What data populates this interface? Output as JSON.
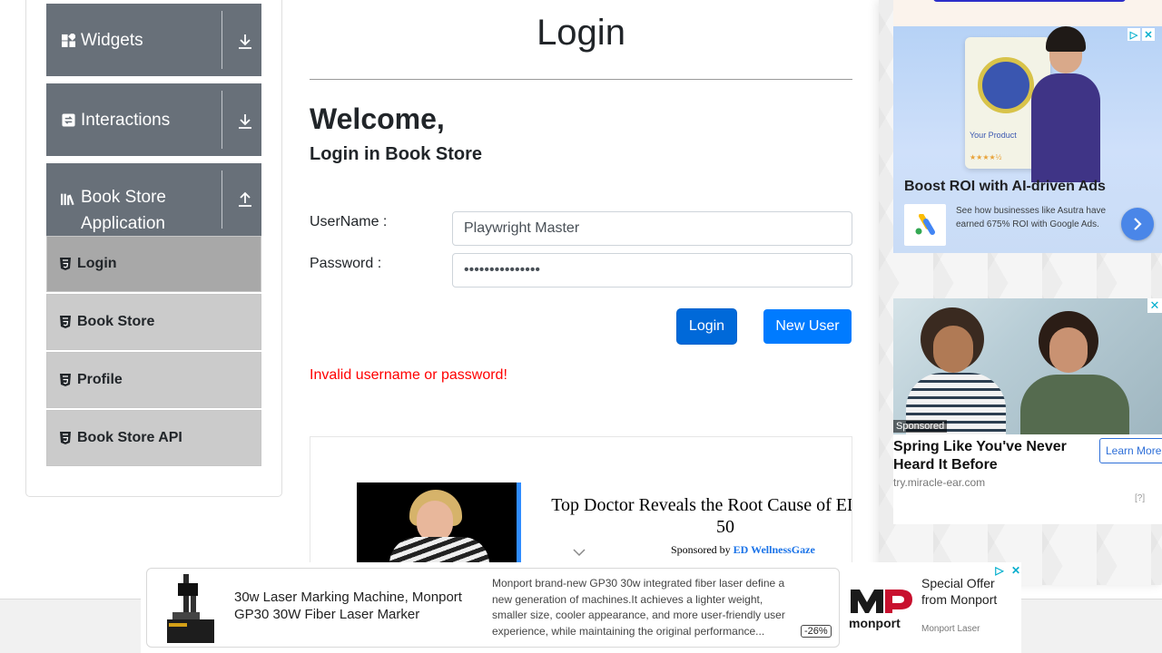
{
  "sidebar": {
    "groups": [
      {
        "title": "Widgets",
        "icon": "widgets-icon",
        "arrow": "download-arrow-icon"
      },
      {
        "title": "Interactions",
        "icon": "interactions-icon",
        "arrow": "download-arrow-icon"
      },
      {
        "title": "Book Store Application",
        "icon": "book-store-icon",
        "arrow": "upload-arrow-icon"
      }
    ],
    "menu_items": [
      {
        "label": "Login",
        "active": true
      },
      {
        "label": "Book Store",
        "active": false
      },
      {
        "label": "Profile",
        "active": false
      },
      {
        "label": "Book Store API",
        "active": false
      }
    ]
  },
  "main": {
    "title": "Login",
    "welcome": "Welcome,",
    "subtitle": "Login in Book Store",
    "username_label": "UserName :",
    "username_value": "Playwright Master",
    "password_label": "Password :",
    "password_value": "•••••••••••••••",
    "login_button": "Login",
    "new_user_button": "New User",
    "error_message": "Invalid username or password!"
  },
  "content_ad": {
    "headline_line1": "Top Doctor Reveals the Root Cause of ED in M",
    "headline_line2": "50",
    "sponsored_prefix": "Sponsored by",
    "sponsor": "ED WellnessGaze"
  },
  "right_ads": {
    "boost": {
      "product_label": "Your Product",
      "product_stars": "★★★★½",
      "title": "Boost ROI with AI-driven Ads",
      "text": "See how businesses like Asutra have earned 675% ROI with Google Ads."
    },
    "spring": {
      "sponsored": "Sponsored",
      "title": "Spring Like You've Never Heard It Before",
      "cta": "Learn More",
      "source": "try.miracle-ear.com",
      "info": "[?]"
    }
  },
  "bottom_ad": {
    "title": "30w Laser Marking Machine, Monport GP30 30W Fiber Laser Marker",
    "description": "Monport brand-new GP30 30w integrated fiber laser define a new generation of machines.It achieves a lighter weight, smaller size, cooler appearance, and more user-friendly user experience, while maintaining the original performance...",
    "discount": "-26%",
    "logo_text": "monport",
    "offer": "Special Offer from Monport",
    "brand": "Monport Laser"
  },
  "colors": {
    "sidebar_header": "#687079",
    "menu_item": "#cbcbcb",
    "menu_item_active": "#a8a8a8",
    "primary_button": "#007bff",
    "error_text": "#ff0000"
  }
}
